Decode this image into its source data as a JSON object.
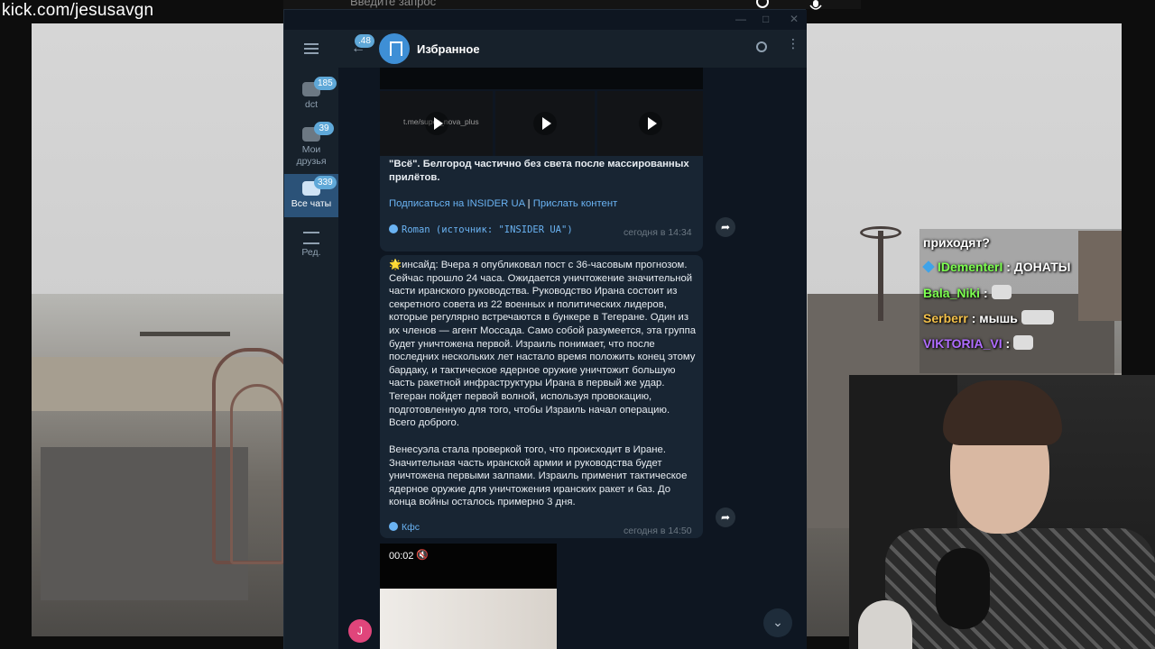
{
  "browser": {
    "url_overlay": "kick.com/jesusavgn",
    "search_placeholder": "Введите запрос"
  },
  "telegram": {
    "rail": {
      "items": [
        {
          "label": "dct",
          "badge": "185"
        },
        {
          "label": "Мои друзья",
          "badge": "39"
        },
        {
          "label": "Все чаты",
          "badge": "339"
        },
        {
          "label": "Ред.",
          "badge": ""
        }
      ]
    },
    "header": {
      "back_badge": "48",
      "title": "Избранное"
    },
    "messages": {
      "m1": {
        "thumb_caption": "t.me/super_nova_plus",
        "headline": "\"Всё\". Белгород частично без света после массированных прилётов.",
        "subscribe_link": "Подписаться на INSIDER UA",
        "separator": "|",
        "send_link": "Прислать контент",
        "author": "Roman (источник: \"INSIDER UA\")",
        "time": "сегодня в 14:34"
      },
      "m2": {
        "text": "🌟инсайд: Вчера я опубликовал пост с 36-часовым прогнозом. Сейчас прошло 24 часа. Ожидается уничтожение значительной части иранского руководства. Руководство Ирана состоит из секретного совета из 22 военных и политических лидеров, которые регулярно встречаются в бункере в Тегеране. Один из их членов — агент Моссада. Само собой разумеется, эта группа будет уничтожена первой. Израиль понимает, что после последних нескольких лет настало время положить конец этому бардаку, и тактическое ядерное оружие уничтожит большую часть ракетной инфраструктуры Ирана в первый же удар. Тегеран пойдет первой волной, используя провокацию, подготовленную для того, чтобы Израиль начал операцию. Всего доброго.",
        "text2": "Венесуэла стала проверкой того, что происходит в Иране. Значительная часть иранской армии и руководства будет уничтожена первыми залпами. Израиль применит тактическое ядерное оружие для уничтожения иранских ракет и баз. До конца войны осталось примерно 3 дня.",
        "author": "Кфс",
        "time": "сегодня в 14:50"
      },
      "m3": {
        "video_time": "00:02"
      }
    },
    "avatar_letter": "J"
  },
  "stream_chat": {
    "lines": [
      {
        "user": "",
        "text": "приходят?",
        "color": "#ffffff"
      },
      {
        "user": "IDementerI",
        "text": ": ДОНАТЫ",
        "color": "#7cff4f"
      },
      {
        "user": "Bala_Niki",
        "text": ":",
        "color": "#7cff4f"
      },
      {
        "user": "Serberr",
        "text": ": мышь",
        "color": "#f3c04a"
      },
      {
        "user": "VIKTORIA_VI",
        "text": ":",
        "color": "#b06cff"
      }
    ]
  }
}
